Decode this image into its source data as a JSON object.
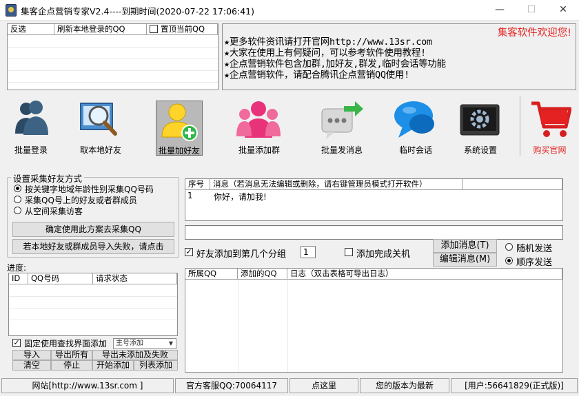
{
  "window": {
    "title": "集客企点营销专家V2.4----到期时间(2020-07-22 17:06:41)",
    "minimize": "—",
    "maximize": "☐",
    "close": "✕"
  },
  "qq_panel": {
    "headers": [
      "反选",
      "刷新本地登录的QQ",
      "置顶当前QQ"
    ],
    "pin_checked": false
  },
  "news": {
    "welcome": "集客软件欢迎您!",
    "lines": [
      "★更多软件资讯请打开官网http://www.13sr.com",
      "★大家在使用上有何疑问，可以参考软件使用教程!",
      "★企点营销软件包含加群,加好友,群发,临时会话等功能",
      "★企点营销软件，请配合腾讯企点营销QQ使用!"
    ]
  },
  "toolbar": {
    "items": [
      {
        "label": "批量登录",
        "icon": "users-icon"
      },
      {
        "label": "取本地好友",
        "icon": "magnifier-icon"
      },
      {
        "label": "批量加好友",
        "icon": "add-user-icon"
      },
      {
        "label": "批量添加群",
        "icon": "group-icon"
      },
      {
        "label": "批量发消息",
        "icon": "message-icon"
      },
      {
        "label": "临时会话",
        "icon": "chat-bubble-icon"
      },
      {
        "label": "系统设置",
        "icon": "gear-icon"
      }
    ],
    "buy_label": "购买官网",
    "buy_color": "#e52222"
  },
  "collect": {
    "legend": "设置采集好友方式",
    "options": [
      "按关键字地域年龄性别采集QQ号码",
      "采集QQ号上的好友或者群成员",
      "从空间采集访客"
    ],
    "selected": 0,
    "confirm_btn": "确定使用此方案去采集QQ",
    "import_btn": "若本地好友或群成员导入失败，请点击"
  },
  "progress": {
    "label": "进度:",
    "headers": [
      "ID",
      "QQ号码",
      "请求状态"
    ],
    "fixed_label": "固定使用查找界面添加",
    "fixed_checked": true,
    "mode_value": "主号添加",
    "buttons_row1": [
      "导入",
      "导出所有",
      "导出未添加及失败"
    ],
    "buttons_row2": [
      "清空",
      "停止",
      "开始添加",
      "列表添加"
    ]
  },
  "messages": {
    "headers": [
      "序号",
      "消息（若消息无法编辑或删除，请右键管理员模式打开软件）"
    ],
    "rows": [
      {
        "num": "1",
        "text": "你好，请加我!"
      }
    ]
  },
  "options": {
    "add_group_label": "好友添加到第几个分组",
    "add_group_checked": true,
    "group_num": "1",
    "shutdown_label": "添加完成关机",
    "shutdown_checked": false,
    "add_msg_btn": "添加消息(T)",
    "edit_msg_btn": "编辑消息(M)",
    "random_label": "随机发送",
    "order_label": "顺序发送",
    "send_mode": "order"
  },
  "log": {
    "headers": [
      "所属QQ",
      "添加的QQ",
      "日志（双击表格可导出日志）"
    ]
  },
  "status": {
    "website": "网站[http://www.13sr.com ]",
    "service": "官方客服QQ:70064117",
    "click_here": "点这里",
    "version": "您的版本为最新",
    "user": "[用户:56641829(正式版)]"
  }
}
